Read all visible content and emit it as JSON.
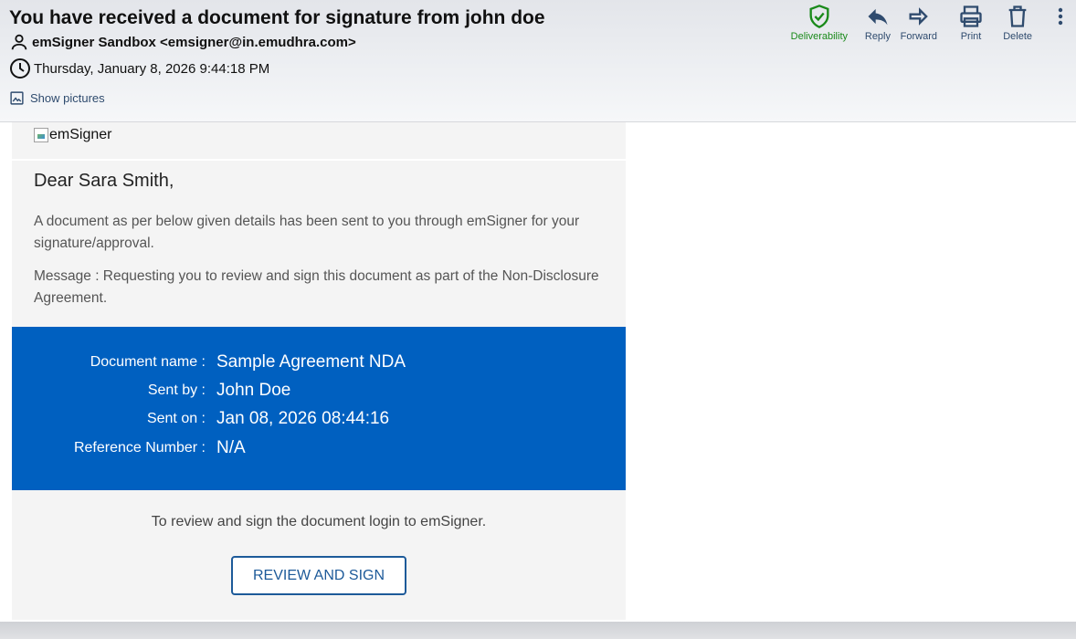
{
  "email": {
    "subject": "You have received a document for signature from john doe",
    "from": "emSigner Sandbox <emsigner@in.emudhra.com>",
    "date": "Thursday, January 8, 2026 9:44:18 PM",
    "show_pictures": "Show pictures"
  },
  "toolbar": {
    "deliverability": "Deliverability",
    "reply": "Reply",
    "forward": "Forward",
    "print": "Print",
    "delete": "Delete"
  },
  "colors": {
    "accent_blue": "#0060c0",
    "button_border": "#1d5a99",
    "deliverability_green": "#1a8a1a",
    "toolbar_icon": "#2f4b6e"
  },
  "body": {
    "logo_alt": "emSigner",
    "greeting": "Dear Sara Smith,",
    "intro": "A document as per below given details has been sent to you through emSigner for your signature/approval.",
    "message": "Message : Requesting you to review and sign this document as part of the Non-Disclosure Agreement.",
    "details": [
      {
        "label": "Document name :",
        "value": "Sample Agreement NDA"
      },
      {
        "label": "Sent by :",
        "value": "John Doe"
      },
      {
        "label": "Sent on :",
        "value": "Jan 08, 2026 08:44:16"
      },
      {
        "label": "Reference Number :",
        "value": "N/A"
      }
    ],
    "cta_text": "To review and sign the document login to emSigner.",
    "cta_button": "REVIEW AND SIGN"
  }
}
